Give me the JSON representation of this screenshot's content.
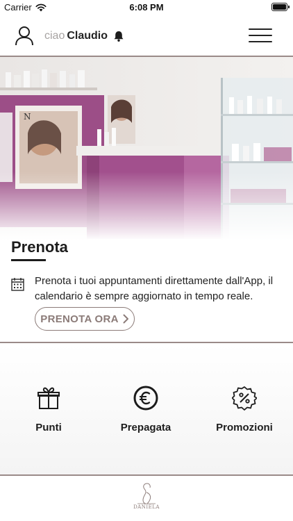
{
  "status_bar": {
    "carrier": "Carrier",
    "time": "6:08 PM"
  },
  "header": {
    "greeting_prefix": "ciao",
    "user_name": "Claudio",
    "icons": [
      "user-icon",
      "bell-icon",
      "menu-icon"
    ]
  },
  "hero": {
    "title": "Prenota",
    "image_description_icon": "salon-photo"
  },
  "booking": {
    "text": "Prenota i tuoi appuntamenti direttamente dall'App, il calendario è sempre aggiornato in tempo reale.",
    "button_label": "PRENOTA ORA",
    "icon": "calendar-icon"
  },
  "features": [
    {
      "label": "Punti",
      "icon": "gift-icon"
    },
    {
      "label": "Prepagata",
      "icon": "euro-icon"
    },
    {
      "label": "Promozioni",
      "icon": "discount-badge-icon"
    }
  ],
  "footer": {
    "logo_text": "DANIELA",
    "logo_icon": "estetica-daniela-logo"
  },
  "colors": {
    "accent": "#8b7b78",
    "divider": "#9a8a88",
    "magenta": "#a54a86",
    "text": "#1c1c1c"
  }
}
